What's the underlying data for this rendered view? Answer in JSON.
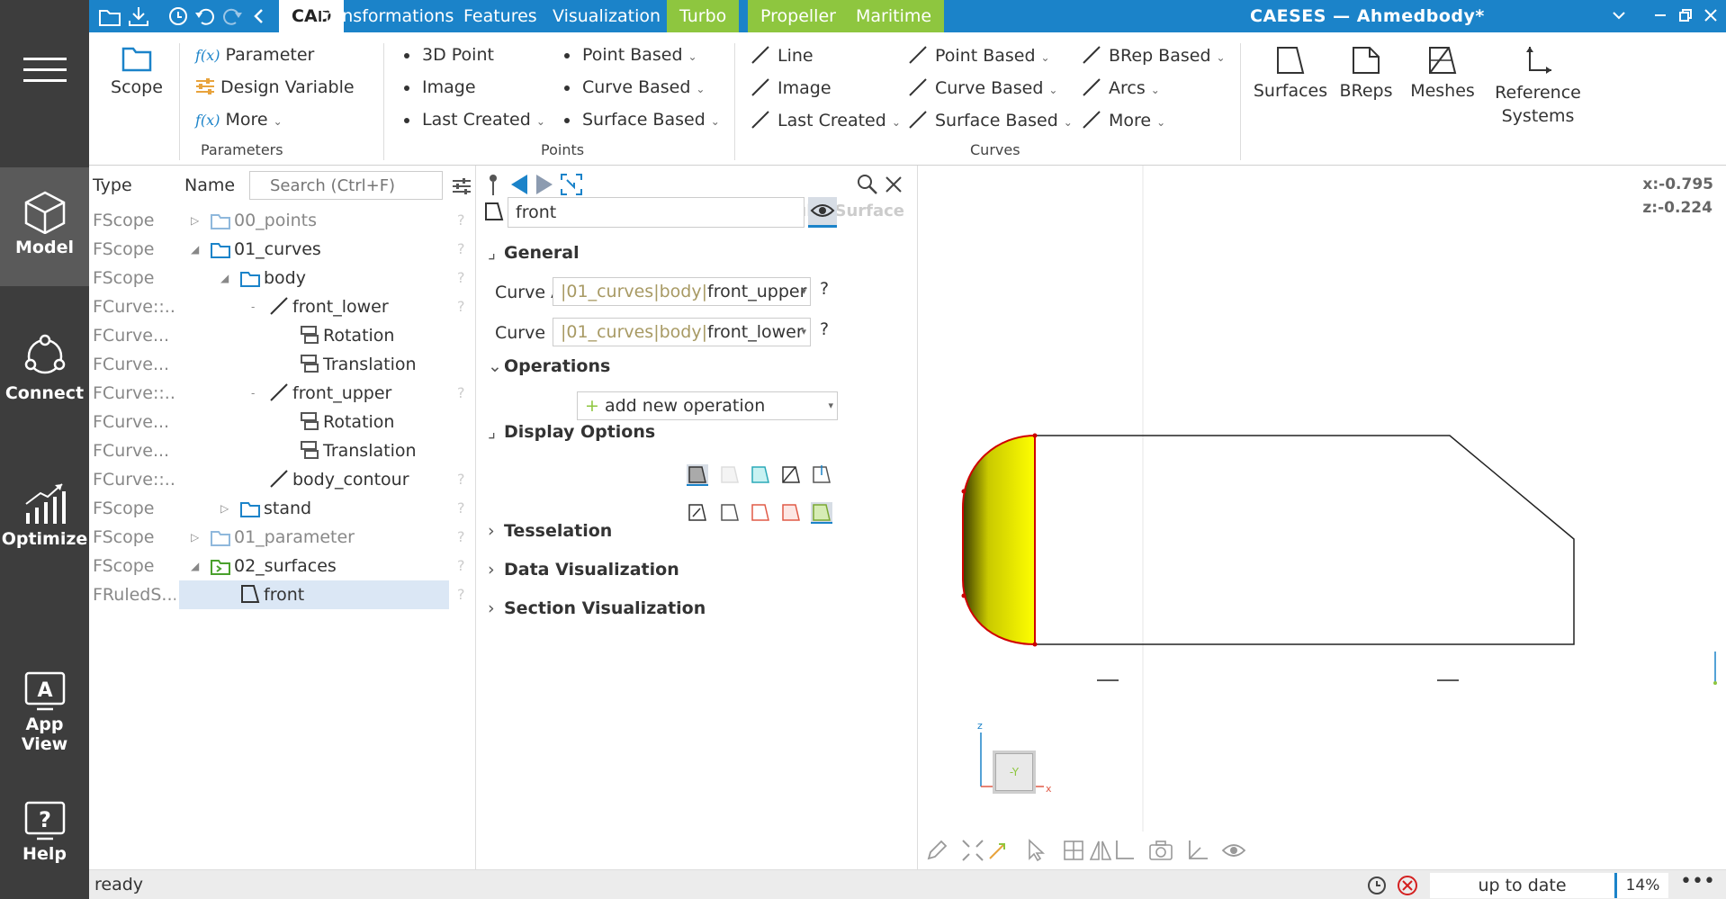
{
  "app": {
    "window_title": "CAESES — Ahmedbody*",
    "tabs": [
      "CAD",
      "Transformations",
      "Features",
      "Visualization",
      "Turbo",
      "Propeller",
      "Maritime"
    ],
    "accent": "#1b83c9",
    "green_tab": "#8ec63f"
  },
  "rail": {
    "model": "Model",
    "connect": "Connect",
    "optimize": "Optimize",
    "app_view": "App View",
    "help": "Help"
  },
  "ribbon": {
    "scope": "Scope",
    "parameter": "Parameter",
    "design_variable": "Design Variable",
    "more": "More",
    "parameters_group": "Parameters",
    "point_3d": "3D Point",
    "image": "Image",
    "last_created": "Last Created",
    "point_based": "Point Based",
    "curve_based": "Curve Based",
    "surface_based": "Surface Based",
    "points_group": "Points",
    "line": "Line",
    "brep_based": "BRep Based",
    "arcs": "Arcs",
    "curves_group": "Curves",
    "surfaces": "Surfaces",
    "breps": "BReps",
    "meshes": "Meshes",
    "reference_systems_1": "Reference",
    "reference_systems_2": "Systems",
    "fx": "f(x)"
  },
  "tree": {
    "col_type": "Type",
    "col_name": "Name",
    "search_placeholder": "Search (Ctrl+F)",
    "rows": [
      {
        "type": "FScope",
        "name": "00_points"
      },
      {
        "type": "FScope",
        "name": "01_curves"
      },
      {
        "type": "FScope",
        "name": "body"
      },
      {
        "type": "FCurve::...",
        "name": "front_lower"
      },
      {
        "type": "FCurve...",
        "name": "Rotation"
      },
      {
        "type": "FCurve...",
        "name": "Translation"
      },
      {
        "type": "FCurve::...",
        "name": "front_upper"
      },
      {
        "type": "FCurve...",
        "name": "Rotation"
      },
      {
        "type": "FCurve...",
        "name": "Translation"
      },
      {
        "type": "FCurve::...",
        "name": "body_contour"
      },
      {
        "type": "FScope",
        "name": "stand"
      },
      {
        "type": "FScope",
        "name": "01_parameter"
      },
      {
        "type": "FScope",
        "name": "02_surfaces"
      },
      {
        "type": "FRuledS...",
        "name": "front"
      }
    ],
    "q": "?"
  },
  "props": {
    "object_type": "FRuledSurface",
    "object_name": "front",
    "general": "General",
    "curve_a_label": "Curve A",
    "curve_a_path": "|01_curves|body|",
    "curve_a_value": "front_upper",
    "curve_b_label": "Curve B",
    "curve_b_path": "|01_curves|body|",
    "curve_b_value": "front_lower",
    "operations": "Operations",
    "add_operation": "add new operation",
    "display_options": "Display Options",
    "tesselation": "Tesselation",
    "data_visualization": "Data Visualization",
    "section_visualization": "Section Visualization",
    "q": "?"
  },
  "viewport": {
    "x_readout": "x:-0.795",
    "z_readout": "z:-0.224",
    "axis_z": "z",
    "axis_x": "x",
    "cube_label": "-Y"
  },
  "status": {
    "text": "ready",
    "uptodate": "up to date",
    "zoom": "14%"
  }
}
